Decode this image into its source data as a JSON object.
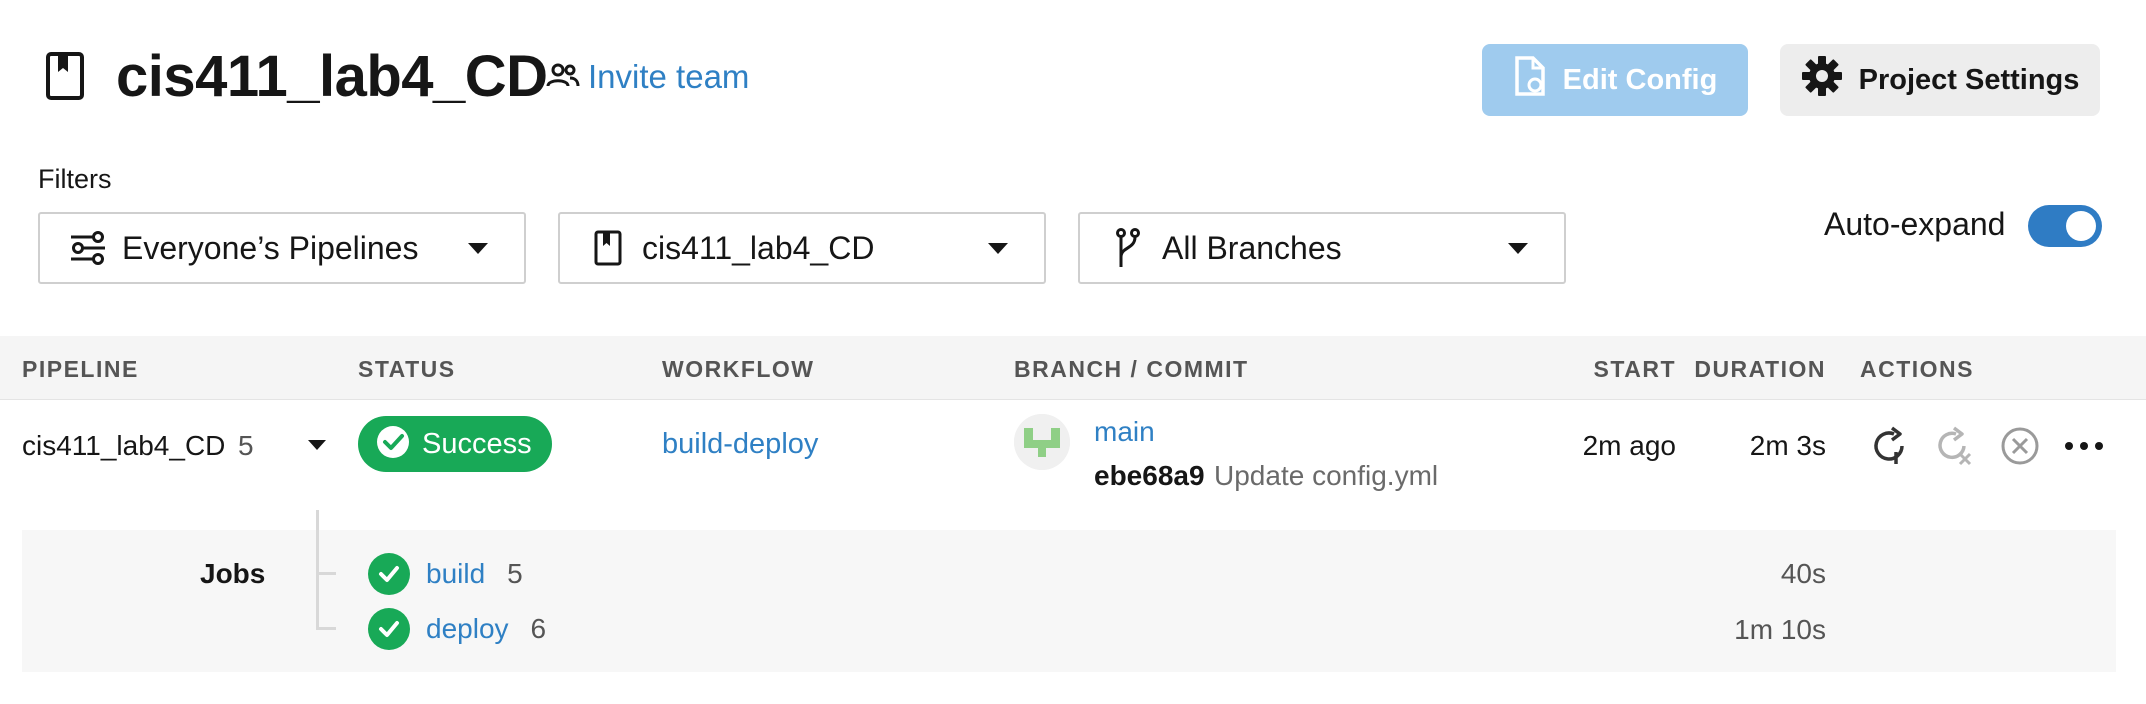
{
  "header": {
    "project_name": "cis411_lab4_CD",
    "invite_label": "Invite team",
    "edit_config_label": "Edit Config",
    "project_settings_label": "Project Settings"
  },
  "filters": {
    "label": "Filters",
    "pipelines_value": "Everyone’s Pipelines",
    "project_value": "cis411_lab4_CD",
    "branches_value": "All Branches",
    "auto_expand_label": "Auto-expand",
    "auto_expand_on": true
  },
  "table": {
    "headers": {
      "pipeline": "PIPELINE",
      "status": "STATUS",
      "workflow": "WORKFLOW",
      "branch_commit": "BRANCH / COMMIT",
      "start": "START",
      "duration": "DURATION",
      "actions": "ACTIONS"
    },
    "row": {
      "pipeline_name": "cis411_lab4_CD",
      "pipeline_number": "5",
      "status": "Success",
      "workflow": "build-deploy",
      "branch": "main",
      "commit_hash": "ebe68a9",
      "commit_message": "Update config.yml",
      "start": "2m ago",
      "duration": "2m 3s"
    },
    "jobs_label": "Jobs",
    "jobs": [
      {
        "name": "build",
        "number": "5",
        "duration": "40s"
      },
      {
        "name": "deploy",
        "number": "6",
        "duration": "1m 10s"
      }
    ]
  },
  "colors": {
    "accent_blue": "#2f80c4",
    "success_green": "#18a957",
    "edit_button_disabled": "#9fcbee"
  },
  "icons": {
    "project": "bookmark-book-icon",
    "invite": "people-icon",
    "edit_config": "file-gear-icon",
    "settings": "gear-icon",
    "pipelines_filter": "sliders-icon",
    "branches_filter": "git-branch-icon",
    "rerun": "rerun-icon",
    "rerun_failed": "rerun-failed-icon",
    "cancel": "cancel-circle-icon",
    "more": "more-dots-icon"
  }
}
